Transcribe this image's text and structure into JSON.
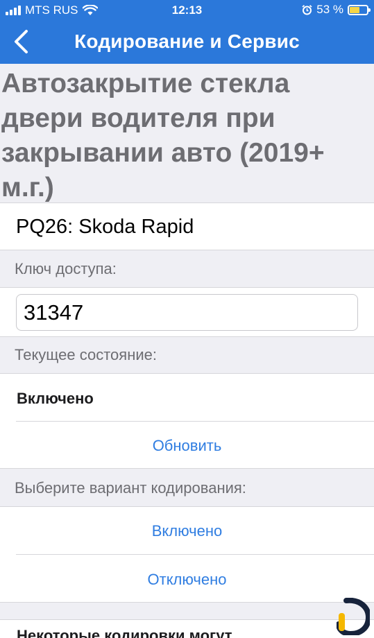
{
  "status_bar": {
    "carrier": "MTS RUS",
    "time": "12:13",
    "battery_percent": "53 %",
    "battery_level": 0.53
  },
  "nav": {
    "title": "Кодирование и Сервис"
  },
  "heading": "Автозакрытие стекла двери водителя при закрывании авто (2019+ м.г.)",
  "model": "PQ26: Skoda Rapid",
  "access_key": {
    "label": "Ключ доступа:",
    "value": "31347"
  },
  "current_state": {
    "label": "Текущее состояние:",
    "value": "Включено",
    "refresh_label": "Обновить"
  },
  "coding": {
    "label": "Выберите вариант кодирования:",
    "options": [
      "Включено",
      "Отключено"
    ]
  },
  "notice": "Некоторые кодировки могут",
  "colors": {
    "accent": "#2b78da",
    "link": "#2f7de1",
    "battery": "#f5d547"
  }
}
